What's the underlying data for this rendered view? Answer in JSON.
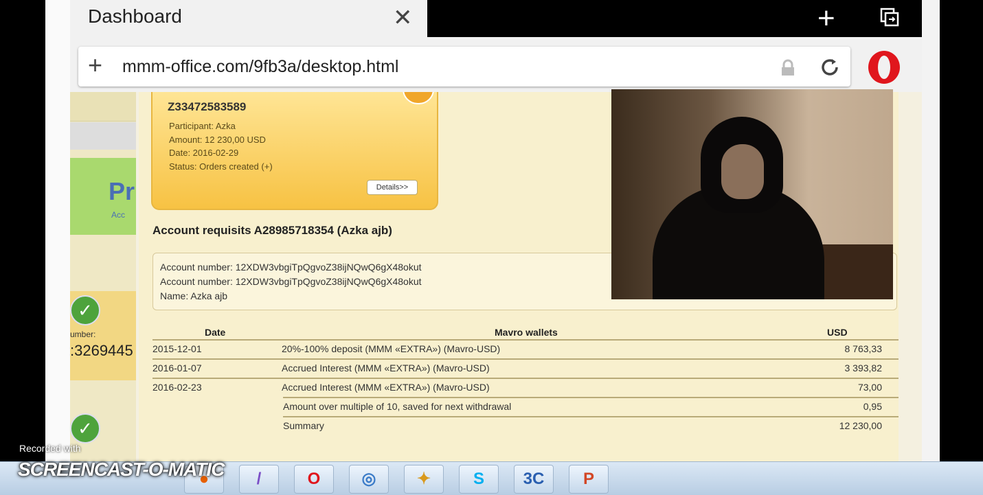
{
  "browser": {
    "tab_title": "Dashboard",
    "url": "mmm-office.com/9fb3a/desktop.html"
  },
  "order": {
    "number": "Z33472583589",
    "participant": "Participant: Azka",
    "amount": "Amount: 12 230,00 USD",
    "date": "Date: 2016-02-29",
    "status": "Status: Orders created (+)",
    "details_button": "Details>>"
  },
  "sidebar": {
    "partial_heading": "Pr",
    "partial_link": "Acc",
    "number_label": "umber:",
    "number_value": ":3269445"
  },
  "requisits": {
    "title": "Account requisits A28985718354 (Azka ajb)",
    "lines": [
      "Account number: 12XDW3vbgiTpQgvoZ38ijNQwQ6gX48okut",
      "Account number: 12XDW3vbgiTpQgvoZ38ijNQwQ6gX48okut",
      "Name: Azka ajb"
    ]
  },
  "table": {
    "headers": {
      "date": "Date",
      "wallets": "Mavro wallets",
      "usd": "USD"
    },
    "rows": [
      {
        "date": "2015-12-01",
        "desc": "20%-100% deposit (MMM «EXTRA») (Mavro-USD)",
        "usd": "8 763,33"
      },
      {
        "date": "2016-01-07",
        "desc": "Accrued Interest (MMM «EXTRA») (Mavro-USD)",
        "usd": "3 393,82"
      },
      {
        "date": "2016-02-23",
        "desc": "Accrued Interest (MMM «EXTRA») (Mavro-USD)",
        "usd": "73,00"
      },
      {
        "date": "",
        "desc": "Amount over multiple of 10, saved for next withdrawal",
        "usd": "0,95"
      },
      {
        "date": "",
        "desc": "Summary",
        "usd": "12 230,00"
      }
    ]
  },
  "watermark": {
    "recorded": "Recorded with",
    "brand": "SCREENCAST-O-MATIC"
  },
  "taskbar": {
    "apps": [
      "firefox",
      "feather",
      "opera",
      "chrome-like",
      "puzzle",
      "skype",
      "3c",
      "powerpoint"
    ]
  }
}
